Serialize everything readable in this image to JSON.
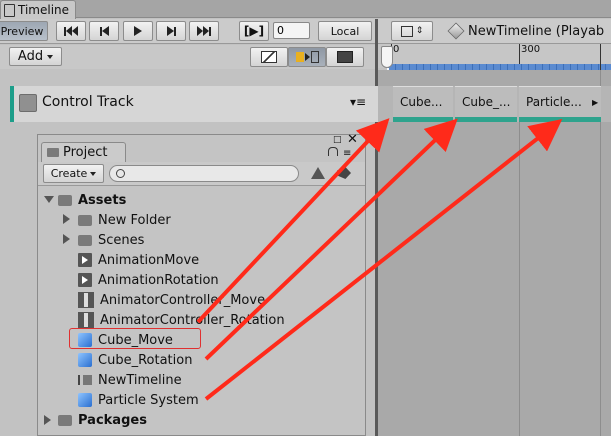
{
  "timeline_window": {
    "tab_title": "Timeline"
  },
  "toolbar": {
    "preview_label": "Preview",
    "frame_value": "0",
    "local_label": "Local",
    "timeline_asset": "NewTimeline (Playab"
  },
  "add_menu": {
    "label": "Add"
  },
  "ruler": {
    "marks": [
      "0",
      "300"
    ]
  },
  "track": {
    "name": "Control Track"
  },
  "clips": [
    {
      "label": "Cube..."
    },
    {
      "label": "Cube_..."
    },
    {
      "label": "Particle..."
    }
  ],
  "project": {
    "tab_label": "Project",
    "create_label": "Create",
    "search_placeholder": "",
    "tree": [
      {
        "label": "Assets",
        "icon": "folder-icon"
      },
      {
        "label": "New Folder",
        "icon": "folder-icon"
      },
      {
        "label": "Scenes",
        "icon": "folder-icon"
      },
      {
        "label": "AnimationMove",
        "icon": "animation-clip-icon"
      },
      {
        "label": "AnimationRotation",
        "icon": "animation-clip-icon"
      },
      {
        "label": "AnimatorController_Move",
        "icon": "animator-controller-icon"
      },
      {
        "label": "AnimatorController_Rotation",
        "icon": "animator-controller-icon"
      },
      {
        "label": "Cube_Move",
        "icon": "prefab-cube-icon"
      },
      {
        "label": "Cube_Rotation",
        "icon": "prefab-cube-icon"
      },
      {
        "label": "NewTimeline",
        "icon": "timeline-asset-icon"
      },
      {
        "label": "Particle System",
        "icon": "prefab-cube-icon"
      },
      {
        "label": "Packages",
        "icon": "folder-icon"
      }
    ]
  },
  "colors": {
    "track_accent": "#1d9e8a",
    "arrow": "#ff2a1a",
    "highlight_box": "#e03030"
  }
}
